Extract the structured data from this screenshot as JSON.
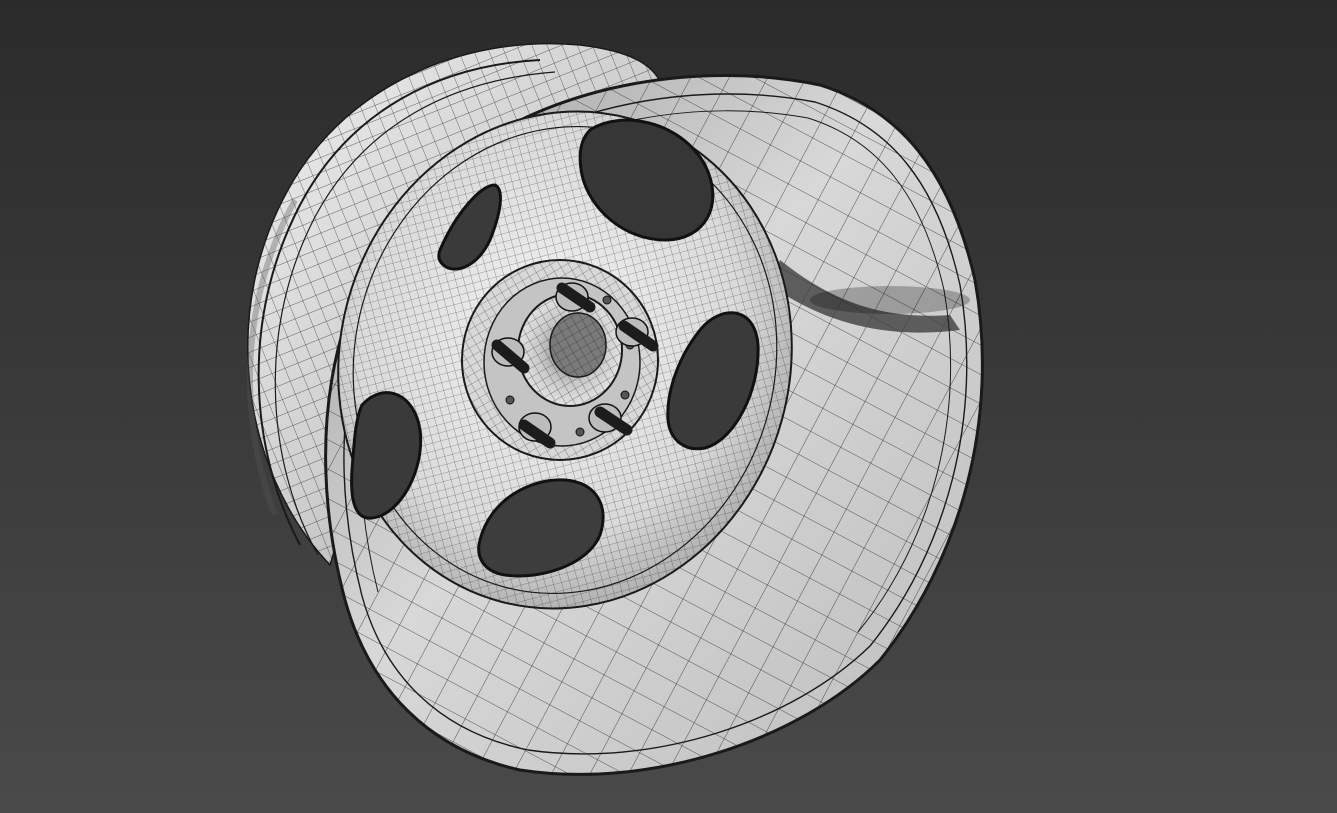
{
  "viewport": {
    "shading_mode": "shaded-with-wireframe",
    "object": "wheel-rim",
    "spoke_count": 5,
    "lug_bolt_count": 5,
    "colors": {
      "background_top": "#2b2b2b",
      "background_bottom": "#4a4a4a",
      "surface_light": "#e4e4e4",
      "surface_mid": "#b8b8b8",
      "surface_dark": "#7a7a7a",
      "wire": "#1a1a1a",
      "hole": "#333333",
      "bolt": "#1c1c1c"
    }
  }
}
